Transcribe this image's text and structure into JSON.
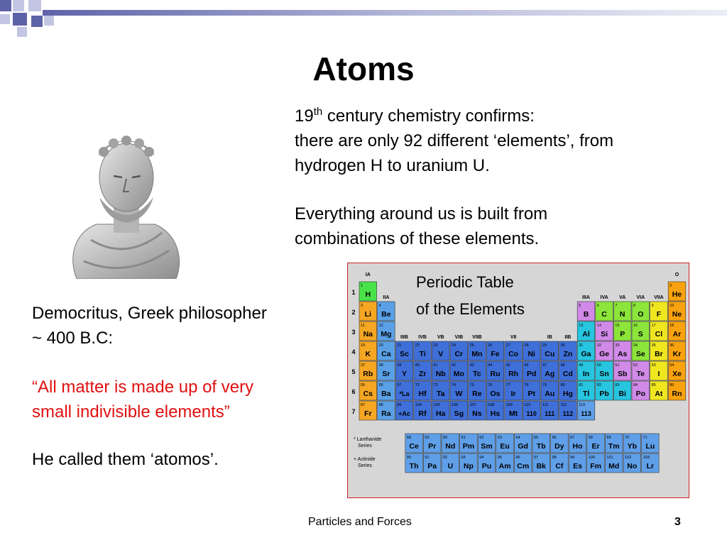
{
  "slide": {
    "title": "Atoms",
    "para1_pre": "19",
    "para1_sup": "th",
    "para1_post": " century chemistry confirms:",
    "para1_line2": "there are only 92 different ‘elements’, from",
    "para1_line3": "hydrogen H to uranium U.",
    "para2_line1": "Everything around us is built from",
    "para2_line2": "combinations of these elements.",
    "caption_line1": "Democritus, Greek philosopher",
    "caption_line2": "~ 400 B.C:",
    "quote_line1": "“All matter is made up of very",
    "quote_line2": "small indivisible elements”",
    "atomos": "He called them ‘atomos’.",
    "footer_title": "Particles and Forces",
    "page_number": "3"
  },
  "periodic_table": {
    "title_line1": "Periodic Table",
    "title_line2": "of the Elements",
    "group_labels": [
      {
        "t": "IA",
        "c": 1,
        "r": 0
      },
      {
        "t": "IIA",
        "c": 2,
        "r": 1
      },
      {
        "t": "IIIB",
        "c": 3,
        "r": 3
      },
      {
        "t": "IVB",
        "c": 4,
        "r": 3
      },
      {
        "t": "VB",
        "c": 5,
        "r": 3
      },
      {
        "t": "VIB",
        "c": 6,
        "r": 3
      },
      {
        "t": "VIIB",
        "c": 7,
        "r": 3
      },
      {
        "t": "VII",
        "c": 9,
        "r": 3
      },
      {
        "t": "IB",
        "c": 11,
        "r": 3
      },
      {
        "t": "IIB",
        "c": 12,
        "r": 3
      },
      {
        "t": "IIIA",
        "c": 13,
        "r": 1
      },
      {
        "t": "IVA",
        "c": 14,
        "r": 1
      },
      {
        "t": "VA",
        "c": 15,
        "r": 1
      },
      {
        "t": "VIA",
        "c": 16,
        "r": 1
      },
      {
        "t": "VIIA",
        "c": 17,
        "r": 1
      },
      {
        "t": "O",
        "c": 18,
        "r": 0
      }
    ],
    "periods": [
      "1",
      "2",
      "3",
      "4",
      "5",
      "6",
      "7"
    ],
    "lanthanide_label": [
      "* Lanthanide",
      "Series"
    ],
    "actinide_label": [
      "+ Actinide",
      "Series"
    ],
    "colors": {
      "alkali": "#f5a623",
      "alkaline": "#5aa0e6",
      "transition": "#3f6fd8",
      "metal": "#27c5e0",
      "metalloid": "#4fd24f",
      "nonmetal": "#8ce53a",
      "halogen": "#f0e620",
      "noble": "#f7a20e",
      "lanthanide": "#5f9fe8",
      "hydrogen": "#49e249",
      "unknown": "#5f9fe8",
      "purple": "#d18ae8"
    },
    "elements": [
      [
        1,
        "H",
        1,
        1,
        "hydrogen"
      ],
      [
        2,
        "He",
        18,
        1,
        "noble"
      ],
      [
        3,
        "Li",
        1,
        2,
        "alkali"
      ],
      [
        4,
        "Be",
        2,
        2,
        "alkaline"
      ],
      [
        5,
        "B",
        13,
        2,
        "purple"
      ],
      [
        6,
        "C",
        14,
        2,
        "nonmetal"
      ],
      [
        7,
        "N",
        15,
        2,
        "nonmetal"
      ],
      [
        8,
        "O",
        16,
        2,
        "nonmetal"
      ],
      [
        9,
        "F",
        17,
        2,
        "halogen"
      ],
      [
        10,
        "Ne",
        18,
        2,
        "noble"
      ],
      [
        11,
        "Na",
        1,
        3,
        "alkali"
      ],
      [
        12,
        "Mg",
        2,
        3,
        "alkaline"
      ],
      [
        13,
        "Al",
        13,
        3,
        "metal"
      ],
      [
        14,
        "Si",
        14,
        3,
        "purple"
      ],
      [
        15,
        "P",
        15,
        3,
        "nonmetal"
      ],
      [
        16,
        "S",
        16,
        3,
        "nonmetal"
      ],
      [
        17,
        "Cl",
        17,
        3,
        "halogen"
      ],
      [
        18,
        "Ar",
        18,
        3,
        "noble"
      ],
      [
        19,
        "K",
        1,
        4,
        "alkali"
      ],
      [
        20,
        "Ca",
        2,
        4,
        "alkaline"
      ],
      [
        21,
        "Sc",
        3,
        4,
        "transition"
      ],
      [
        22,
        "Ti",
        4,
        4,
        "transition"
      ],
      [
        23,
        "V",
        5,
        4,
        "transition"
      ],
      [
        24,
        "Cr",
        6,
        4,
        "transition"
      ],
      [
        25,
        "Mn",
        7,
        4,
        "transition"
      ],
      [
        26,
        "Fe",
        8,
        4,
        "transition"
      ],
      [
        27,
        "Co",
        9,
        4,
        "transition"
      ],
      [
        28,
        "Ni",
        10,
        4,
        "transition"
      ],
      [
        29,
        "Cu",
        11,
        4,
        "transition"
      ],
      [
        30,
        "Zn",
        12,
        4,
        "transition"
      ],
      [
        31,
        "Ga",
        13,
        4,
        "metal"
      ],
      [
        32,
        "Ge",
        14,
        4,
        "purple"
      ],
      [
        33,
        "As",
        15,
        4,
        "purple"
      ],
      [
        34,
        "Se",
        16,
        4,
        "nonmetal"
      ],
      [
        35,
        "Br",
        17,
        4,
        "halogen"
      ],
      [
        36,
        "Kr",
        18,
        4,
        "noble"
      ],
      [
        37,
        "Rb",
        1,
        5,
        "alkali"
      ],
      [
        38,
        "Sr",
        2,
        5,
        "alkaline"
      ],
      [
        39,
        "Y",
        3,
        5,
        "transition"
      ],
      [
        40,
        "Zr",
        4,
        5,
        "transition"
      ],
      [
        41,
        "Nb",
        5,
        5,
        "transition"
      ],
      [
        42,
        "Mo",
        6,
        5,
        "transition"
      ],
      [
        43,
        "Tc",
        7,
        5,
        "transition"
      ],
      [
        44,
        "Ru",
        8,
        5,
        "transition"
      ],
      [
        45,
        "Rh",
        9,
        5,
        "transition"
      ],
      [
        46,
        "Pd",
        10,
        5,
        "transition"
      ],
      [
        47,
        "Ag",
        11,
        5,
        "transition"
      ],
      [
        48,
        "Cd",
        12,
        5,
        "transition"
      ],
      [
        49,
        "In",
        13,
        5,
        "metal"
      ],
      [
        50,
        "Sn",
        14,
        5,
        "metal"
      ],
      [
        51,
        "Sb",
        15,
        5,
        "purple"
      ],
      [
        52,
        "Te",
        16,
        5,
        "purple"
      ],
      [
        53,
        "I",
        17,
        5,
        "halogen"
      ],
      [
        54,
        "Xe",
        18,
        5,
        "noble"
      ],
      [
        55,
        "Cs",
        1,
        6,
        "alkali"
      ],
      [
        56,
        "Ba",
        2,
        6,
        "alkaline"
      ],
      [
        57,
        "*La",
        3,
        6,
        "transition"
      ],
      [
        72,
        "Hf",
        4,
        6,
        "transition"
      ],
      [
        73,
        "Ta",
        5,
        6,
        "transition"
      ],
      [
        74,
        "W",
        6,
        6,
        "transition"
      ],
      [
        75,
        "Re",
        7,
        6,
        "transition"
      ],
      [
        76,
        "Os",
        8,
        6,
        "transition"
      ],
      [
        77,
        "Ir",
        9,
        6,
        "transition"
      ],
      [
        78,
        "Pt",
        10,
        6,
        "transition"
      ],
      [
        79,
        "Au",
        11,
        6,
        "transition"
      ],
      [
        80,
        "Hg",
        12,
        6,
        "transition"
      ],
      [
        81,
        "Tl",
        13,
        6,
        "metal"
      ],
      [
        82,
        "Pb",
        14,
        6,
        "metal"
      ],
      [
        83,
        "Bi",
        15,
        6,
        "metal"
      ],
      [
        84,
        "Po",
        16,
        6,
        "purple"
      ],
      [
        85,
        "At",
        17,
        6,
        "halogen"
      ],
      [
        86,
        "Rn",
        18,
        6,
        "noble"
      ],
      [
        87,
        "Fr",
        1,
        7,
        "alkali"
      ],
      [
        88,
        "Ra",
        2,
        7,
        "alkaline"
      ],
      [
        89,
        "+Ac",
        3,
        7,
        "transition"
      ],
      [
        104,
        "Rf",
        4,
        7,
        "transition"
      ],
      [
        105,
        "Ha",
        5,
        7,
        "transition"
      ],
      [
        106,
        "Sg",
        6,
        7,
        "transition"
      ],
      [
        107,
        "Ns",
        7,
        7,
        "transition"
      ],
      [
        108,
        "Hs",
        8,
        7,
        "transition"
      ],
      [
        109,
        "Mt",
        9,
        7,
        "transition"
      ],
      [
        110,
        "110",
        10,
        7,
        "transition"
      ],
      [
        111,
        "111",
        11,
        7,
        "transition"
      ],
      [
        112,
        "112",
        12,
        7,
        "transition"
      ],
      [
        113,
        "113",
        13,
        7,
        "unknown"
      ]
    ],
    "lanthanides": [
      [
        58,
        "Ce"
      ],
      [
        59,
        "Pr"
      ],
      [
        60,
        "Nd"
      ],
      [
        61,
        "Pm"
      ],
      [
        62,
        "Sm"
      ],
      [
        63,
        "Eu"
      ],
      [
        64,
        "Gd"
      ],
      [
        65,
        "Tb"
      ],
      [
        66,
        "Dy"
      ],
      [
        67,
        "Ho"
      ],
      [
        68,
        "Er"
      ],
      [
        69,
        "Tm"
      ],
      [
        70,
        "Yb"
      ],
      [
        71,
        "Lu"
      ]
    ],
    "actinides": [
      [
        90,
        "Th"
      ],
      [
        91,
        "Pa"
      ],
      [
        92,
        "U"
      ],
      [
        93,
        "Np"
      ],
      [
        94,
        "Pu"
      ],
      [
        95,
        "Am"
      ],
      [
        96,
        "Cm"
      ],
      [
        97,
        "Bk"
      ],
      [
        98,
        "Cf"
      ],
      [
        99,
        "Es"
      ],
      [
        100,
        "Fm"
      ],
      [
        101,
        "Md"
      ],
      [
        102,
        "No"
      ],
      [
        103,
        "Lr"
      ]
    ]
  }
}
